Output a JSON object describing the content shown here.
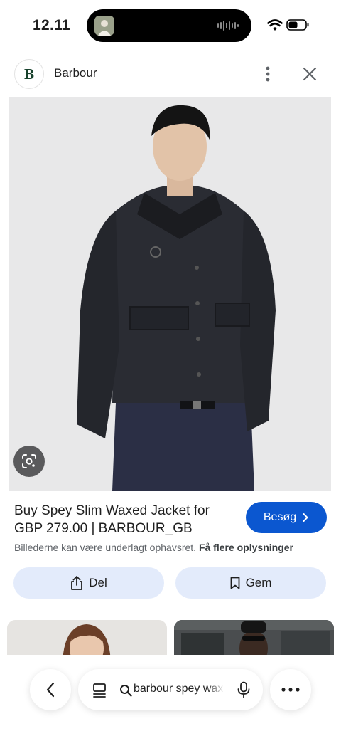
{
  "status_bar": {
    "time": "12.11"
  },
  "header": {
    "logo_letter": "B",
    "site_name": "Barbour"
  },
  "product": {
    "title": "Buy Spey Slim Waxed Jacket for GBP 279.00 | BARBOUR_GB",
    "visit_label": "Besøg",
    "copyright_text": "Billederne kan være underlagt ophavsret.",
    "more_info_link": "Få flere oplysninger"
  },
  "actions": {
    "share_label": "Del",
    "save_label": "Gem"
  },
  "bottom_bar": {
    "search_query": "barbour spey wax"
  },
  "colors": {
    "accent": "#0b57d0",
    "action_bg": "#e3ebfb",
    "logo_green": "#17412c"
  },
  "icons": [
    "wifi-icon",
    "battery-icon",
    "more-vert-icon",
    "close-icon",
    "google-lens-icon",
    "chevron-right-icon",
    "share-icon",
    "bookmark-icon",
    "back-arrow-icon",
    "tabs-icon",
    "search-icon",
    "mic-icon",
    "more-horiz-icon"
  ]
}
